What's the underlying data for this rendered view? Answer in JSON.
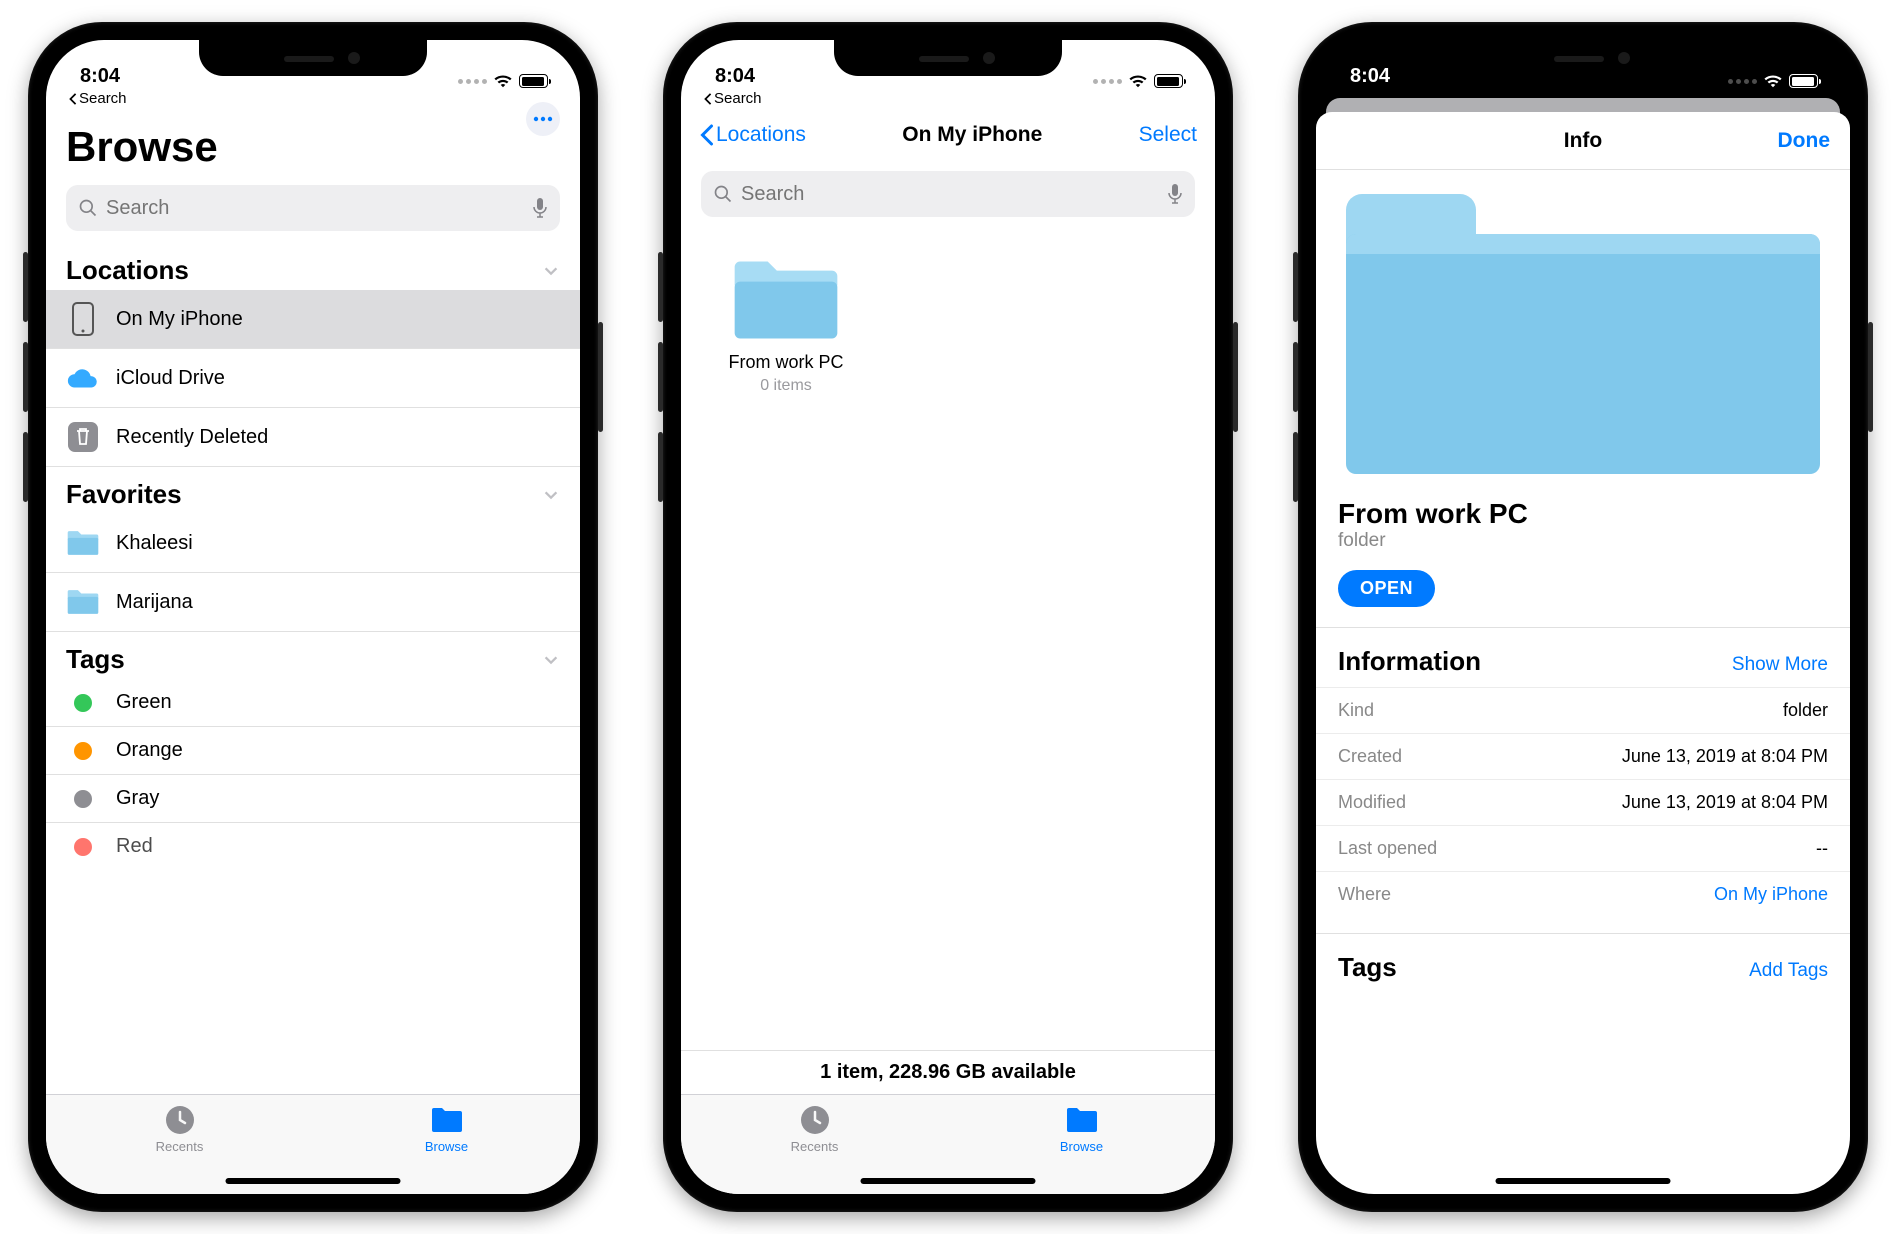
{
  "status": {
    "time": "8:04",
    "back_app": "Search"
  },
  "screen1": {
    "title": "Browse",
    "search_placeholder": "Search",
    "sections": {
      "locations": {
        "title": "Locations",
        "items": [
          {
            "label": "On My iPhone",
            "icon": "phone",
            "selected": true
          },
          {
            "label": "iCloud Drive",
            "icon": "cloud"
          },
          {
            "label": "Recently Deleted",
            "icon": "trash"
          }
        ]
      },
      "favorites": {
        "title": "Favorites",
        "items": [
          {
            "label": "Khaleesi"
          },
          {
            "label": "Marijana"
          }
        ]
      },
      "tags": {
        "title": "Tags",
        "items": [
          {
            "label": "Green",
            "color": "#34c759"
          },
          {
            "label": "Orange",
            "color": "#ff9500"
          },
          {
            "label": "Gray",
            "color": "#8e8e93"
          },
          {
            "label": "Red",
            "color": "#ff3b30"
          }
        ]
      }
    },
    "tabs": {
      "recents": "Recents",
      "browse": "Browse"
    }
  },
  "screen2": {
    "nav_back": "Locations",
    "nav_title": "On My iPhone",
    "nav_action": "Select",
    "search_placeholder": "Search",
    "items": [
      {
        "name": "From work PC",
        "subtitle": "0 items"
      }
    ],
    "footer": "1 item, 228.96 GB available",
    "tabs": {
      "recents": "Recents",
      "browse": "Browse"
    }
  },
  "screen3": {
    "nav_title": "Info",
    "nav_done": "Done",
    "name": "From work PC",
    "kind_label": "folder",
    "open_label": "OPEN",
    "info_header": "Information",
    "show_more": "Show More",
    "rows": [
      {
        "k": "Kind",
        "v": "folder"
      },
      {
        "k": "Created",
        "v": "June 13, 2019 at 8:04 PM"
      },
      {
        "k": "Modified",
        "v": "June 13, 2019 at 8:04 PM"
      },
      {
        "k": "Last opened",
        "v": "--"
      },
      {
        "k": "Where",
        "v": "On My iPhone",
        "link": true
      }
    ],
    "tags_header": "Tags",
    "add_tags": "Add Tags"
  }
}
